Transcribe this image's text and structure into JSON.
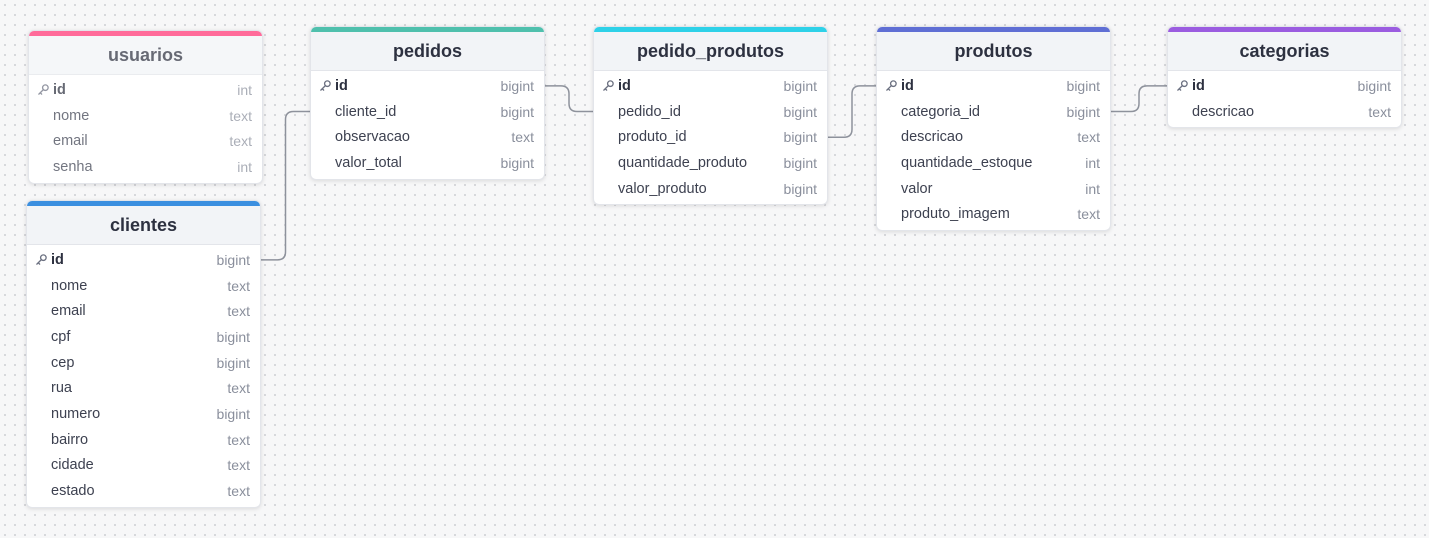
{
  "tables": {
    "usuarios": {
      "name": "usuarios",
      "color": "#ff6b9a",
      "columns": [
        {
          "name": "id",
          "type": "int",
          "pk": true
        },
        {
          "name": "nome",
          "type": "text"
        },
        {
          "name": "email",
          "type": "text"
        },
        {
          "name": "senha",
          "type": "int"
        }
      ]
    },
    "clientes": {
      "name": "clientes",
      "color": "#3b8fe0",
      "columns": [
        {
          "name": "id",
          "type": "bigint",
          "pk": true
        },
        {
          "name": "nome",
          "type": "text"
        },
        {
          "name": "email",
          "type": "text"
        },
        {
          "name": "cpf",
          "type": "bigint"
        },
        {
          "name": "cep",
          "type": "bigint"
        },
        {
          "name": "rua",
          "type": "text"
        },
        {
          "name": "numero",
          "type": "bigint"
        },
        {
          "name": "bairro",
          "type": "text"
        },
        {
          "name": "cidade",
          "type": "text"
        },
        {
          "name": "estado",
          "type": "text"
        }
      ]
    },
    "pedidos": {
      "name": "pedidos",
      "color": "#4fc0ad",
      "columns": [
        {
          "name": "id",
          "type": "bigint",
          "pk": true
        },
        {
          "name": "cliente_id",
          "type": "bigint"
        },
        {
          "name": "observacao",
          "type": "text"
        },
        {
          "name": "valor_total",
          "type": "bigint"
        }
      ]
    },
    "pedido_produtos": {
      "name": "pedido_produtos",
      "color": "#2ed1e8",
      "columns": [
        {
          "name": "id",
          "type": "bigint",
          "pk": true
        },
        {
          "name": "pedido_id",
          "type": "bigint"
        },
        {
          "name": "produto_id",
          "type": "bigint"
        },
        {
          "name": "quantidade_produto",
          "type": "bigint"
        },
        {
          "name": "valor_produto",
          "type": "bigint"
        }
      ]
    },
    "produtos": {
      "name": "produtos",
      "color": "#5f6ed4",
      "columns": [
        {
          "name": "id",
          "type": "bigint",
          "pk": true
        },
        {
          "name": "categoria_id",
          "type": "bigint"
        },
        {
          "name": "descricao",
          "type": "text"
        },
        {
          "name": "quantidade_estoque",
          "type": "int"
        },
        {
          "name": "valor",
          "type": "int"
        },
        {
          "name": "produto_imagem",
          "type": "text"
        }
      ]
    },
    "categorias": {
      "name": "categorias",
      "color": "#9b5ce0",
      "columns": [
        {
          "name": "id",
          "type": "bigint",
          "pk": true
        },
        {
          "name": "descricao",
          "type": "text"
        }
      ]
    }
  },
  "relations": [
    {
      "from_table": "clientes",
      "from_column": "id",
      "to_table": "pedidos",
      "to_column": "cliente_id"
    },
    {
      "from_table": "pedidos",
      "from_column": "id",
      "to_table": "pedido_produtos",
      "to_column": "pedido_id"
    },
    {
      "from_table": "pedido_produtos",
      "from_column": "produto_id",
      "to_table": "produtos",
      "to_column": "id"
    },
    {
      "from_table": "produtos",
      "from_column": "categoria_id",
      "to_table": "categorias",
      "to_column": "id"
    }
  ],
  "colors": {
    "edge": "#8e929c",
    "header_bg": "#f2f4f7",
    "type_text": "#8a8f9c"
  },
  "icons": {
    "primary_key": "key-icon"
  }
}
